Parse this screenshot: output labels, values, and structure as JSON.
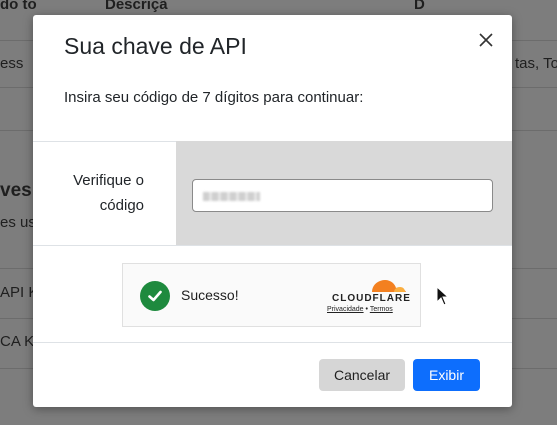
{
  "background": {
    "header_fragments": [
      "do to",
      "Descriçã",
      "D"
    ],
    "row1_fragments": [
      "ess",
      "tas, To"
    ],
    "section_heading": "ves",
    "section_sub": "es us",
    "row_a": "API K",
    "row_b": "CA K"
  },
  "modal": {
    "title": "Sua chave de API",
    "instruction": "Insira seu código de 7 dígitos para continuar:",
    "verify_label_line1": "Verifique o",
    "verify_label_line2": "código",
    "captcha": {
      "status": "Sucesso!",
      "brand": "CLOUDFLARE",
      "privacy_link": "Privacidade",
      "separator": "•",
      "terms_link": "Termos"
    },
    "cancel_label": "Cancelar",
    "show_label": "Exibir"
  },
  "colors": {
    "primary": "#0d6efd",
    "success": "#1e8a3e",
    "cloudflare_orange": "#f38020"
  }
}
